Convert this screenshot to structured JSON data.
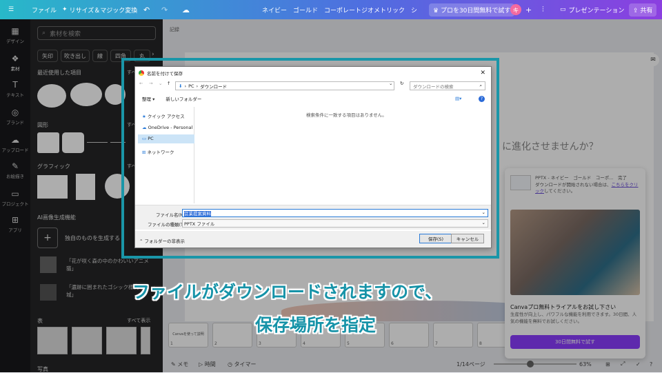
{
  "topbar": {
    "menu_icon": "menu-icon",
    "file": "ファイル",
    "resize": "リサイズ＆マジック変換",
    "title": "ネイビー　ゴールド　コーポレートジオメトリック　シンプル...",
    "trial": "プロを30日間無料で試す",
    "avatar": "キ",
    "present": "プレゼンテーション",
    "share": "共有"
  },
  "rail": {
    "items": [
      {
        "label": "デザイン",
        "icon": "design-icon"
      },
      {
        "label": "素材",
        "icon": "elements-icon"
      },
      {
        "label": "テキスト",
        "icon": "text-icon"
      },
      {
        "label": "ブランド",
        "icon": "brand-icon"
      },
      {
        "label": "アップロード",
        "icon": "upload-icon"
      },
      {
        "label": "お絵描き",
        "icon": "draw-icon"
      },
      {
        "label": "プロジェクト",
        "icon": "folder-icon"
      },
      {
        "label": "アプリ",
        "icon": "apps-icon"
      }
    ]
  },
  "panel": {
    "search_placeholder": "素材を検索",
    "tags": [
      "矢印",
      "吹き出し",
      "線",
      "四角",
      "丸"
    ],
    "recent": "最近使用した項目",
    "shapes": "図形",
    "graphics": "グラフィック",
    "ai": "AI画像生成機能",
    "ai_create": "独自のものを生成する",
    "ai_item1": "「花が咲く森の中のかわいいアニメ猫」",
    "ai_item2": "「遺跡に囲まれたゴシック様式の城」",
    "table": "表",
    "show_all": "すべて表示",
    "photo": "写真",
    "see_all_short": "すべ"
  },
  "canvas": {
    "page_label": "記録",
    "cta_text": "に進化させませんか？",
    "page_info": "1/14ページ",
    "zoom": "63%",
    "memo": "メモ",
    "time": "時間",
    "timer": "タイマー",
    "thumb_numbers": [
      "1",
      "2",
      "3",
      "4",
      "5",
      "6",
      "7",
      "8",
      "9"
    ],
    "first_thumb_title": "Canvaを使って説明"
  },
  "promo": {
    "file_line": "PPTX - ネイビー　ゴールド　コーポ...　完了",
    "body": "ダウンロードが開始されない場合は、",
    "link": "こちらをクリック",
    "body2": "してください。",
    "headline": "Canvaプロ無料トライアルをお試し下さい",
    "desc": "生産性が向上し、パワフルな機能を利用できます。30日間、人気の機能を無料でお試しください。",
    "button": "30日間無料で試す"
  },
  "dialog": {
    "title": "名前を付けて保存",
    "path_pc": "PC",
    "path_folder": "ダウンロード",
    "search_placeholder": "ダウンロードの検索",
    "organize": "整理 ▾",
    "new_folder": "新しいフォルダー",
    "empty_msg": "検索条件に一致する項目はありません。",
    "nav": [
      "クイック アクセス",
      "OneDrive - Personal",
      "PC",
      "ネットワーク"
    ],
    "filename_label": "ファイル名(N):",
    "filename_value": "営業提案資料",
    "filetype_label": "ファイルの種類(T):",
    "filetype_value": "PPTX ファイル",
    "hide_folders": "フォルダーの非表示",
    "save": "保存(S)",
    "cancel": "キャンセル"
  },
  "caption": {
    "line1": "ファイルがダウンロードされますので、",
    "line2": "保存場所を指定"
  },
  "colors": {
    "accent_teal": "#1693a8",
    "highlight_border": "#1a96a8",
    "purple_button": "#8b3dff"
  }
}
